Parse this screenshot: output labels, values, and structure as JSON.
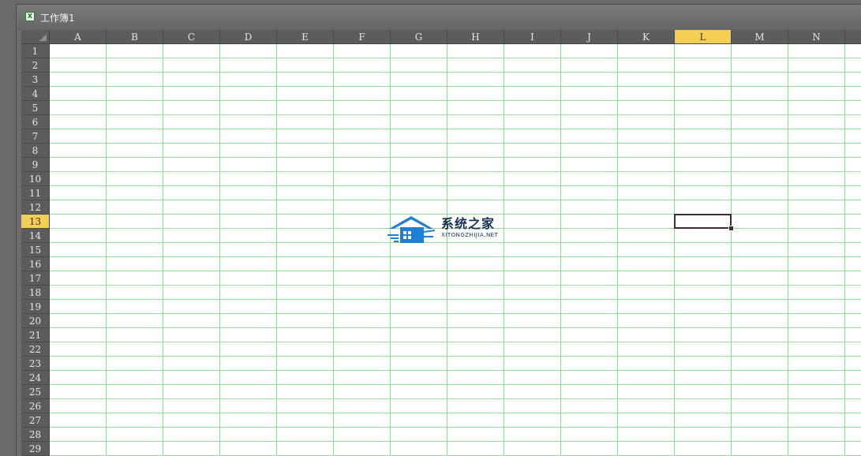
{
  "window": {
    "title": "工作簿1",
    "title_icon": "excel-workbook-icon"
  },
  "sheet": {
    "columns": [
      "A",
      "B",
      "C",
      "D",
      "E",
      "F",
      "G",
      "H",
      "I",
      "J",
      "K",
      "L",
      "M",
      "N",
      ""
    ],
    "rows": [
      "1",
      "2",
      "3",
      "4",
      "5",
      "6",
      "7",
      "8",
      "9",
      "10",
      "11",
      "12",
      "13",
      "14",
      "15",
      "16",
      "17",
      "18",
      "19",
      "20",
      "21",
      "22",
      "23",
      "24",
      "25",
      "26",
      "27",
      "28",
      "29"
    ],
    "active_column": "L",
    "active_row": "13",
    "gridline_color": "#9ed69e",
    "header_color": "#5c5c5c",
    "active_header_color": "#f5cf52"
  },
  "watermark": {
    "title": "系统之家",
    "subtitle": "XITONGZHIJIA.NET",
    "icon": "house-logo-icon"
  }
}
